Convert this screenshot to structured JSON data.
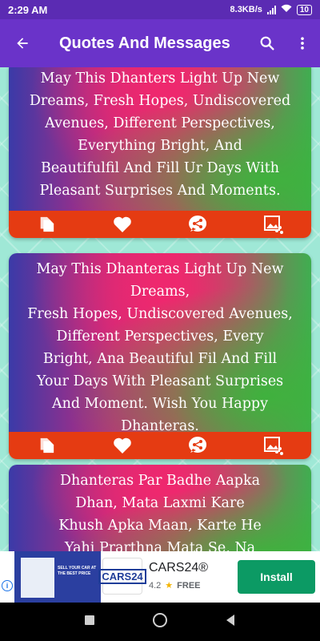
{
  "status_bar": {
    "time": "2:29 AM",
    "speed": "8.3KB/s",
    "battery": "10"
  },
  "app_bar": {
    "title": "Quotes And Messages",
    "icons": [
      "back-arrow-icon",
      "search-icon",
      "more-vert-icon"
    ]
  },
  "cards": [
    {
      "text": "May This Dhanters Light Up New\nDreams, Fresh Hopes, Undiscovered\nAvenues, Different Perspectives,\nEverything Bright, And\nBeautifulfil And Fill Ur Days With\nPleasant Surprises And Moments.",
      "actions": [
        "copy-icon",
        "heart-icon",
        "share-icon",
        "image-share-icon"
      ]
    },
    {
      "text": "May This Dhanteras Light Up New\nDreams,\nFresh Hopes, Undiscovered Avenues,\nDifferent Perspectives, Every\nBright, Ana Beautiful Fil And Fill\nYour Days With Pleasant Surprises\nAnd Moment. Wish You Happy Dhanteras.",
      "actions": [
        "copy-icon",
        "heart-icon",
        "share-icon",
        "image-share-icon"
      ]
    },
    {
      "text": "Dhanteras Par Badhe Aapka\nDhan, Mata Laxmi Kare\nKhush Apka Maan, Karte He\nYahi Prarthna Mata Se, Na"
    }
  ],
  "ad": {
    "banner_text": "SELL YOUR CAR AT THE BEST PRICE",
    "logo_text": "CARS24",
    "app_name": "CARS24®",
    "rating": "4.2",
    "price": "FREE",
    "install_label": "Install"
  },
  "colors": {
    "status_bar": "#5b2bb3",
    "app_bar": "#6a33c9",
    "action_bar": "#e53b12",
    "background": "#9fe8d6",
    "install_button": "#0c9a64"
  }
}
